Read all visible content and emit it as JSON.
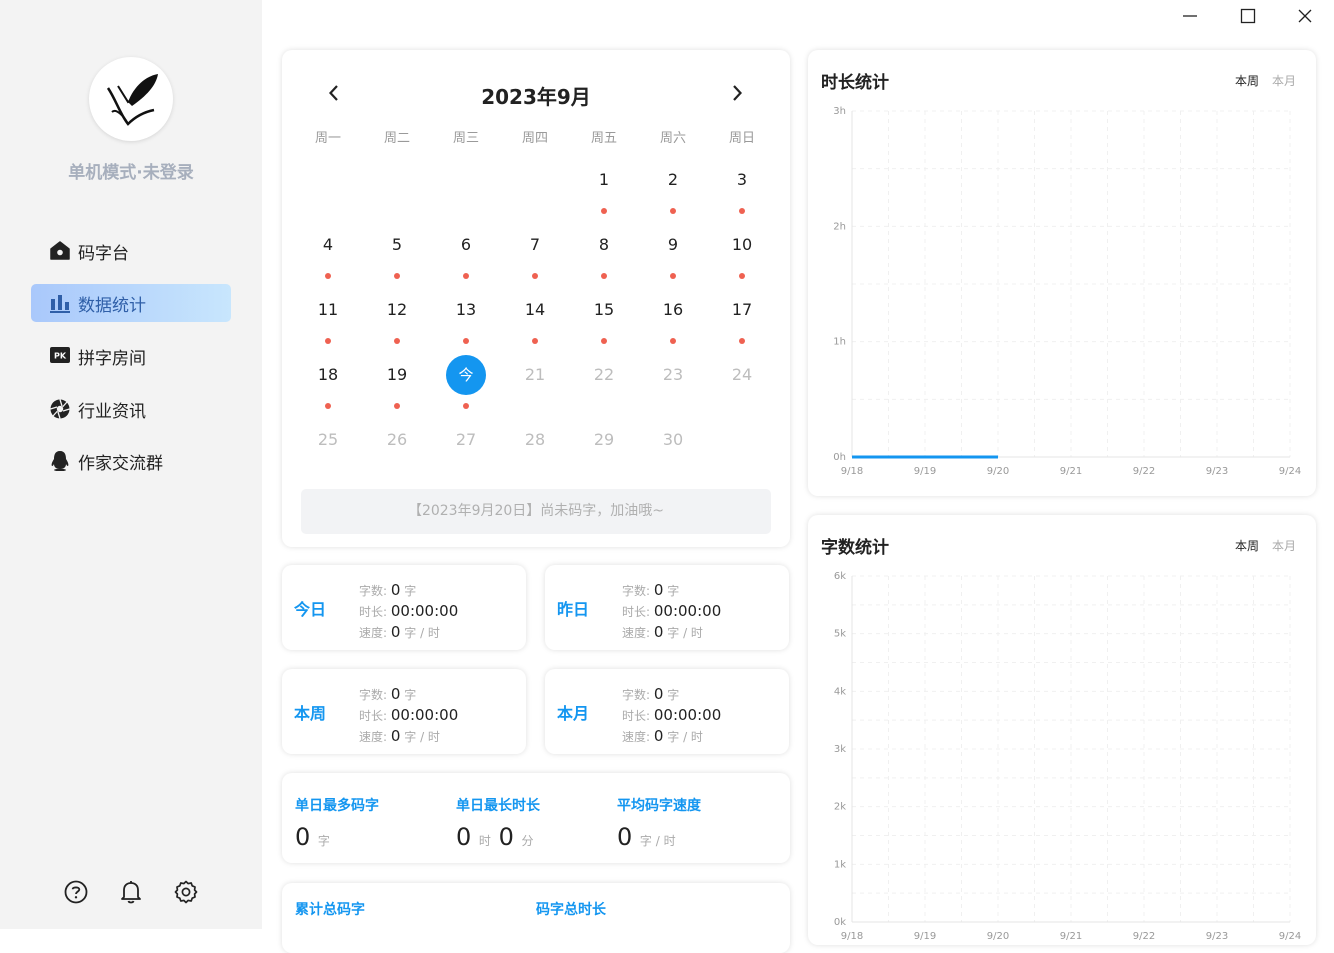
{
  "sidebar": {
    "user_mode": "单机模式·未登录",
    "nav": [
      {
        "label": "码字台",
        "icon": "home-icon"
      },
      {
        "label": "数据统计",
        "icon": "bar-chart-icon"
      },
      {
        "label": "拼字房间",
        "icon": "pk-icon"
      },
      {
        "label": "行业资讯",
        "icon": "aperture-icon"
      },
      {
        "label": "作家交流群",
        "icon": "qq-penguin-icon"
      }
    ],
    "active_item": "数据统计",
    "bottom_icons": [
      "help-icon",
      "bell-icon",
      "gear-icon"
    ]
  },
  "window_controls": [
    "minimize-icon",
    "maximize-icon",
    "close-icon"
  ],
  "calendar": {
    "title": "2023年9月",
    "weekdays": [
      "周一",
      "周二",
      "周三",
      "周四",
      "周五",
      "周六",
      "周日"
    ],
    "first_weekday_offset": 4,
    "days_in_month": 30,
    "today": 20,
    "today_label": "今",
    "message": "【2023年9月20日】尚未码字，加油哦~"
  },
  "stats": {
    "today": {
      "title": "今日",
      "words_label": "字数:",
      "words": "0",
      "words_unit": "字",
      "duration_label": "时长:",
      "duration": "00:00:00",
      "speed_label": "速度:",
      "speed": "0",
      "speed_unit": "字 / 时"
    },
    "yesterday": {
      "title": "昨日",
      "words_label": "字数:",
      "words": "0",
      "words_unit": "字",
      "duration_label": "时长:",
      "duration": "00:00:00",
      "speed_label": "速度:",
      "speed": "0",
      "speed_unit": "字 / 时"
    },
    "week": {
      "title": "本周",
      "words_label": "字数:",
      "words": "0",
      "words_unit": "字",
      "duration_label": "时长:",
      "duration": "00:00:00",
      "speed_label": "速度:",
      "speed": "0",
      "speed_unit": "字 / 时"
    },
    "month": {
      "title": "本月",
      "words_label": "字数:",
      "words": "0",
      "words_unit": "字",
      "duration_label": "时长:",
      "duration": "00:00:00",
      "speed_label": "速度:",
      "speed": "0",
      "speed_unit": "字 / 时"
    }
  },
  "records": {
    "max_words_label": "单日最多码字",
    "max_words": "0",
    "max_words_unit": "字",
    "max_duration_label": "单日最长时长",
    "max_hours": "0",
    "hour_unit": "时",
    "max_minutes": "0",
    "minute_unit": "分",
    "avg_speed_label": "平均码字速度",
    "avg_speed": "0",
    "avg_speed_unit": "字 / 时",
    "total_words_label": "累计总码字",
    "total_duration_label": "码字总时长"
  },
  "colors": {
    "accent": "#1496f0",
    "dot": "#ef6151",
    "label_gray": "#a7afbd"
  },
  "chart_data": [
    {
      "type": "line",
      "title": "时长统计",
      "tabs": [
        "本周",
        "本月"
      ],
      "active_tab": "本周",
      "x": [
        "9/18",
        "9/19",
        "9/20",
        "9/21",
        "9/22",
        "9/23",
        "9/24"
      ],
      "y_ticks": [
        "0h",
        "1h",
        "2h",
        "3h"
      ],
      "ylim": [
        0,
        3
      ],
      "series": [
        {
          "values": [
            0,
            0,
            0
          ]
        }
      ],
      "grid": true
    },
    {
      "type": "line",
      "title": "字数统计",
      "tabs": [
        "本周",
        "本月"
      ],
      "active_tab": "本周",
      "x": [
        "9/18",
        "9/19",
        "9/20",
        "9/21",
        "9/22",
        "9/23",
        "9/24"
      ],
      "y_ticks": [
        "0k",
        "1k",
        "2k",
        "3k",
        "4k",
        "5k",
        "6k"
      ],
      "ylim": [
        0,
        6000
      ],
      "series": [],
      "grid": true
    }
  ]
}
